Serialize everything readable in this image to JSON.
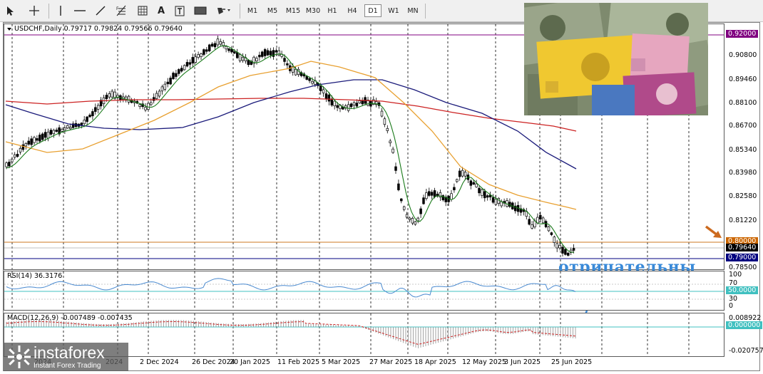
{
  "toolbar": {
    "tools": [
      {
        "id": "cursor",
        "icon": "cursor-arrow-icon"
      },
      {
        "id": "crosshair",
        "icon": "crosshair-icon"
      },
      {
        "id": "vline",
        "icon": "vertical-line-icon"
      },
      {
        "id": "hline",
        "icon": "horizontal-line-icon"
      },
      {
        "id": "trend",
        "icon": "trendline-icon"
      },
      {
        "id": "fibo",
        "icon": "fibonacci-icon"
      },
      {
        "id": "grid",
        "icon": "equidistant-channel-icon"
      },
      {
        "id": "text",
        "icon": "text-icon",
        "glyph": "A"
      },
      {
        "id": "label",
        "icon": "text-label-icon"
      },
      {
        "id": "rect",
        "icon": "rectangle-icon"
      },
      {
        "id": "shapes",
        "icon": "shapes-dropdown-icon"
      }
    ],
    "timeframes": [
      "M1",
      "M5",
      "M15",
      "M30",
      "H1",
      "H4",
      "D1",
      "W1",
      "MN"
    ],
    "active_timeframe": "D1"
  },
  "chart": {
    "title": "USDCHF,Daily  0.79717 0.79824 0.79566 0.79640",
    "price_levels": [
      "0.92000",
      "0.90800",
      "0.89460",
      "0.88100",
      "0.86700",
      "0.85340",
      "0.83980",
      "0.82580",
      "0.81220",
      "0.80000",
      "0.79640",
      "0.79000",
      "0.78500"
    ],
    "tags": [
      {
        "value": "0.92000",
        "color": "#800080"
      },
      {
        "value": "0.80000",
        "color": "#cc6600"
      },
      {
        "value": "0.79640",
        "color": "#000000"
      },
      {
        "value": "0.79000",
        "color": "#000080"
      }
    ],
    "dates": [
      "2 Dec 2024",
      "26 Dec 2024",
      "20 Jan 2025",
      "11 Feb 2025",
      "5 Mar 2025",
      "27 Mar 2025",
      "18 Apr 2025",
      "12 May 2025",
      "3 Jun 2025",
      "25 Jun 2025"
    ],
    "dates_partial": [
      "2024",
      "2024"
    ],
    "annotation": "отрицательны",
    "colors": {
      "ma_fast": "#1a7a1a",
      "ma_mid": "#e8a030",
      "ma_slow": "#1a1a7a",
      "ma_red": "#cc2222",
      "bg": "#ffffff",
      "candle": "#000000"
    }
  },
  "rsi": {
    "title": "RSI(14) 36.3176",
    "levels": [
      "100",
      "70",
      "50.0000",
      "30",
      "0"
    ],
    "current_tag": "50.0000"
  },
  "macd": {
    "title": "MACD(12,26,9) -0.007489 -0.007435",
    "levels": [
      "0.008922",
      "0.000000",
      "-0.020757"
    ],
    "current_tag": "0.000000"
  },
  "watermark": {
    "brand": "instaforex",
    "tagline": "Instant Forex Trading"
  }
}
